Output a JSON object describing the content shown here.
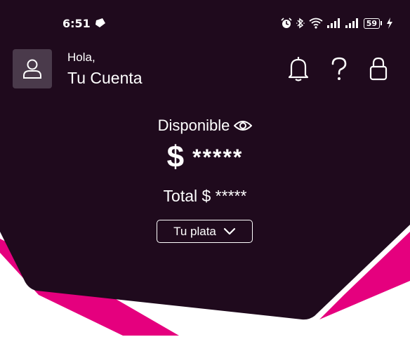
{
  "colors": {
    "panel": "#1f0a1d",
    "accent": "#e5007e",
    "background": "#ffffff",
    "text": "#ffffff"
  },
  "status_bar": {
    "time": "6:51",
    "battery": "59",
    "icons": [
      "notification-icon",
      "alarm-icon",
      "bluetooth-icon",
      "wifi-icon",
      "signal-icon",
      "signal-icon",
      "battery-icon",
      "charging-icon"
    ]
  },
  "header": {
    "greeting": "Hola,",
    "account_name": "Tu Cuenta",
    "actions": [
      "bell-icon",
      "help-icon",
      "lock-icon"
    ]
  },
  "balance": {
    "label": "Disponible",
    "currency": "$",
    "masked_amount": "*****",
    "total_text": "Total $ *****"
  },
  "selector": {
    "selected": "Tu plata"
  }
}
